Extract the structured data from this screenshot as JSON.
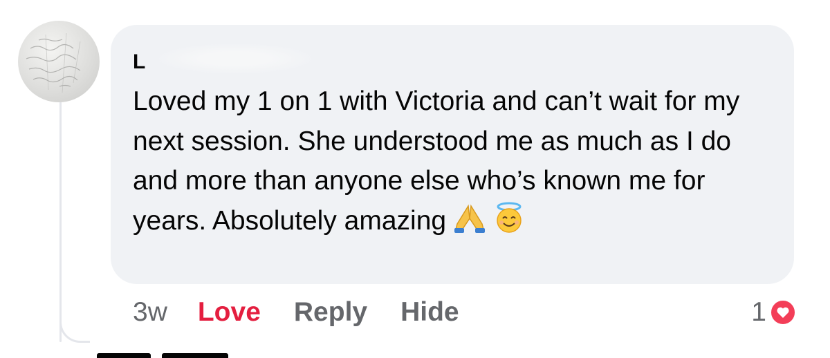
{
  "comment": {
    "author_visible": "L",
    "text": "Loved my 1 on 1 with Victoria and can’t wait for my next session. She understood me as much as I do and more than anyone else who’s known me for years. Absolutely amazing",
    "emojis": [
      "folded-hands-icon",
      "smiling-face-with-halo-icon"
    ]
  },
  "actions": {
    "time": "3w",
    "love_label": "Love",
    "reply_label": "Reply",
    "hide_label": "Hide"
  },
  "reactions": {
    "count": "1",
    "type": "heart-reaction-icon",
    "color": "#f33e58"
  },
  "colors": {
    "bubble": "#f0f2f5",
    "love_active": "#e41e3f",
    "secondary_text": "#65676b"
  }
}
